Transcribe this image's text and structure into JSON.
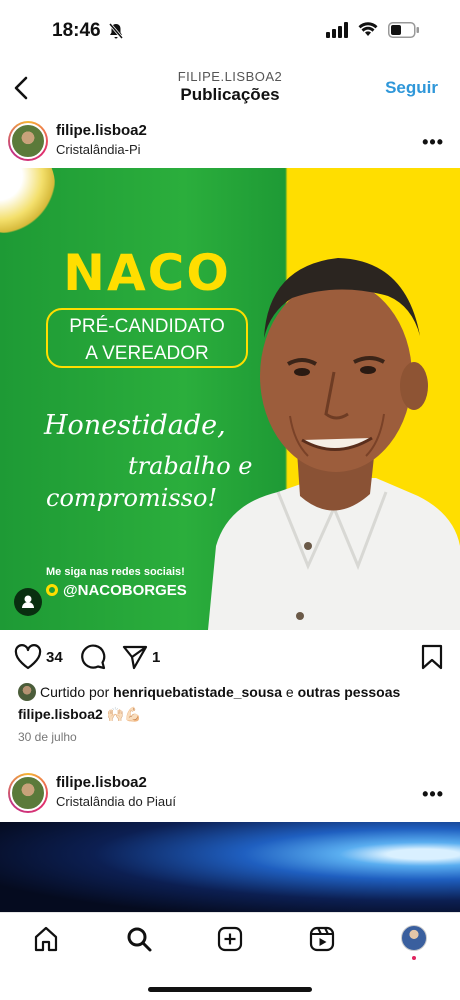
{
  "status_bar": {
    "time": "18:46"
  },
  "header": {
    "username": "FILIPE.LISBOA2",
    "title": "Publicações",
    "follow_label": "Seguir"
  },
  "post1": {
    "username": "filipe.lisboa2",
    "location": "Cristalândia-Pi",
    "image": {
      "name": "NACO",
      "role_line1": "PRÉ-CANDIDATO",
      "role_line2": "A VEREADOR",
      "slogan1": "Honestidade,",
      "slogan2": "trabalho e",
      "slogan3": "compromisso!",
      "follow_text": "Me siga nas redes sociais!",
      "handle": "@NACOBORGES",
      "colors": {
        "green": "#2bae3c",
        "yellow": "#ffde00"
      }
    },
    "likes_count": "34",
    "shares_count": "1",
    "liked_by_prefix": "Curtido por",
    "liked_by_user": "henriquebatistade_sousa",
    "liked_by_and": "e",
    "liked_by_others": "outras pessoas",
    "caption_user": "filipe.lisboa2",
    "caption_emoji": "🙌🏻💪🏻",
    "date": "30 de julho"
  },
  "post2": {
    "username": "filipe.lisboa2",
    "location": "Cristalândia do Piauí"
  },
  "nav": {
    "icons": [
      "home-icon",
      "search-icon",
      "create-icon",
      "reels-icon",
      "profile-avatar"
    ]
  }
}
